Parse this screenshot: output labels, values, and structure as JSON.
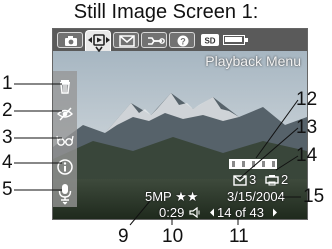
{
  "title": "Still Image Screen 1:",
  "tabs": [
    {
      "icon": "camera-icon"
    },
    {
      "icon": "playback-icon",
      "selected": true
    },
    {
      "icon": "share-icon"
    },
    {
      "icon": "setup-icon"
    },
    {
      "icon": "help-icon"
    },
    {
      "icon": "sd-card-icon"
    },
    {
      "icon": "battery-icon"
    }
  ],
  "mode_label": "Playback Menu",
  "side_menu": [
    {
      "icon": "delete-icon"
    },
    {
      "icon": "remove-red-eyes-icon"
    },
    {
      "icon": "image-advice-icon"
    },
    {
      "icon": "image-info-icon"
    },
    {
      "icon": "record-audio-icon"
    }
  ],
  "status": {
    "share_count": "3",
    "print_count": "2",
    "resolution_quality": "5MP ★★",
    "date": "3/15/2004",
    "audio_time": "0:29",
    "image_counter": "14 of 43"
  },
  "callouts": {
    "n1": "1",
    "n2": "2",
    "n3": "3",
    "n4": "4",
    "n5": "5",
    "n9": "9",
    "n10": "10",
    "n11": "11",
    "n12": "12",
    "n13": "13",
    "n14": "14",
    "n15": "15"
  },
  "colors": {
    "tab_bar": "#5a5a5a",
    "selected_tab": "#e9e9e9",
    "sky": "#b6c4ce",
    "mountain": "#4e5b62",
    "foreground": "#2e3a2b"
  }
}
